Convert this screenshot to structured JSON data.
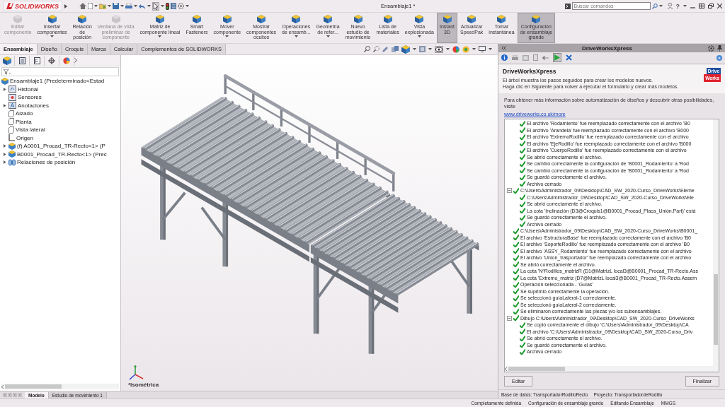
{
  "titlebar": {
    "logo": "SOLIDWORKS",
    "title": "Ensamblaje1 *",
    "search": {
      "placeholder": "Buscar comandos"
    },
    "help": "?"
  },
  "ribbon": [
    {
      "label": "Editar\ncomponente",
      "disabled": true,
      "selected": false,
      "dropdown": false
    },
    {
      "label": "Insertar\ncomponentes",
      "disabled": false,
      "selected": false,
      "dropdown": true
    },
    {
      "label": "Relación\nde\nposición",
      "disabled": false,
      "selected": false,
      "dropdown": false
    },
    {
      "label": "Ventana de vista\npreliminar de\ncomponente",
      "disabled": true,
      "selected": false,
      "dropdown": false
    },
    {
      "label": "Matriz de\ncomponente lineal",
      "disabled": false,
      "selected": false,
      "dropdown": true
    },
    {
      "label": "Smart\nFasteners",
      "disabled": false,
      "selected": false,
      "dropdown": false
    },
    {
      "label": "Mover\ncomponente",
      "disabled": false,
      "selected": false,
      "dropdown": true
    },
    {
      "label": "Mostrar\ncomponentes\nocultos",
      "disabled": false,
      "selected": false,
      "dropdown": false
    },
    {
      "label": "Operaciones\nde ensamb...",
      "disabled": false,
      "selected": false,
      "dropdown": true
    },
    {
      "label": "Geometría\nde refer...",
      "disabled": false,
      "selected": false,
      "dropdown": true
    },
    {
      "label": "Nuevo\nestudio de\nmovimiento",
      "disabled": false,
      "selected": false,
      "dropdown": false
    },
    {
      "label": "Lista de\nmateriales",
      "disabled": false,
      "selected": false,
      "dropdown": false
    },
    {
      "label": "Vista\nexplosionada",
      "disabled": false,
      "selected": false,
      "dropdown": true
    },
    {
      "label": "Instant\n3D",
      "disabled": false,
      "selected": true,
      "dropdown": false
    },
    {
      "label": "Actualizar\nSpeedPak",
      "disabled": false,
      "selected": false,
      "dropdown": false
    },
    {
      "label": "Tomar\ninstantánea",
      "disabled": false,
      "selected": false,
      "dropdown": false
    },
    {
      "label": "Configuración\nde ensamblaje\ngrande",
      "disabled": false,
      "selected": true,
      "dropdown": false
    }
  ],
  "command_tabs": [
    {
      "label": "Ensamblaje",
      "selected": true
    },
    {
      "label": "Diseño",
      "selected": false
    },
    {
      "label": "Croquis",
      "selected": false
    },
    {
      "label": "Marca",
      "selected": false
    },
    {
      "label": "Calcular",
      "selected": false
    },
    {
      "label": "Complementos de SOLIDWORKS",
      "selected": false
    }
  ],
  "feature_tree": {
    "items": [
      {
        "label": "Ensamblaje1  (Predeterminado<Estad",
        "kind": "assembly",
        "children": [
          {
            "label": "Historial",
            "kind": "history",
            "expanded": false
          },
          {
            "label": "Sensores",
            "kind": "sensor"
          },
          {
            "label": "Anotaciones",
            "kind": "annotation",
            "expanded": false
          },
          {
            "label": "Alzado",
            "kind": "plane"
          },
          {
            "label": "Planta",
            "kind": "plane"
          },
          {
            "label": "Vista lateral",
            "kind": "plane"
          },
          {
            "label": "Origen",
            "kind": "origin"
          },
          {
            "label": "(f) A0001_Procad_TR-Recto<1> (P",
            "kind": "assembly",
            "expanded": false
          },
          {
            "label": "B0001_Procad_TR-Recto<1> (Prec",
            "kind": "assembly",
            "expanded": false
          },
          {
            "label": "Relaciones de posición",
            "kind": "mates",
            "expanded": false
          }
        ]
      }
    ]
  },
  "viewport": {
    "view_name": "*Isométrica"
  },
  "drive_works": {
    "title": "DriveWorksXpress",
    "heading": "DriveWorksXpress",
    "description": "El árbol muestra los pasos seguidos para crear los modelos nuevos.\nHaga clic en Siguiente para volver a ejecutar el formulario y crear más modelos.",
    "logo": [
      "Drive",
      "Works"
    ],
    "info": "Para obtener más información sobre automatización de diseños y descubrir otras posibilidades, visite",
    "link": "www.driveworks.co.uk/more",
    "log": [
      {
        "children": [
          {
            "text": "El archivo 'Rodamiento' fue reemplazado correctamente con el archivo 'B0"
          },
          {
            "text": "El archivo 'Arandela' fue reemplazado correctamente con el archivo 'B000"
          },
          {
            "text": "El archivo 'ExtremoRodillo' fue reemplazado correctamente con el archivo"
          },
          {
            "text": "El archivo 'EjeRodillo' fue reemplazado correctamente con el archivo 'B000"
          },
          {
            "text": "El archivo 'CuerpoRodillo' fue reemplazado correctamente con el archivo"
          },
          {
            "text": "Se abrió correctamente el archivo."
          },
          {
            "text": "Se cambió correctamente la configuración de 'B0001_Rodamiento' a 'Rod"
          },
          {
            "text": "Se cambió correctamente la configuración de 'B0001_Rodamiento' a 'Rod"
          },
          {
            "text": "Se guardó correctamente el archivo."
          },
          {
            "text": "Archivo cerrado"
          }
        ]
      },
      {
        "text": "C:\\Users\\Administrador_09\\Desktop\\CAD_SW_2020-Curso_DriveWorks\\Eleme",
        "expanded": true,
        "children": [
          {
            "text": "C:\\Users\\Administrador_09\\Desktop\\CAD_SW_2020-Curso_DriveWorks\\Ele"
          },
          {
            "text": "Se abrió correctamente el archivo."
          },
          {
            "text": "La cota 'Inclinación (D3@Croquis1@B0001_Procad_Placa_Unión.Part)' está"
          },
          {
            "text": "Se guardó correctamente el archivo."
          },
          {
            "text": "Archivo cerrado"
          }
        ]
      },
      {
        "text": "C:\\Users\\Administrador_09\\Desktop\\CAD_SW_2020-Curso_DriveWorks\\B0001_"
      },
      {
        "text": "El archivo 'EstructuraBase' fue reemplazado correctamente con el archivo 'B0"
      },
      {
        "text": "El archivo 'SoporteRodillo' fue reemplazado correctamente con el archivo 'B0"
      },
      {
        "text": "El archivo 'ASSY_Rodamiento' fue reemplazado correctamente con el archivo"
      },
      {
        "text": "El archivo 'Union_trasportador' fue reemplazado correctamente con el archivo"
      },
      {
        "text": "Se abrió correctamente el archivo."
      },
      {
        "text": "La cota 'NºRodillos_matrizR (D1@MatrizL local3@B0001_Procad_TR-Recto.Ass"
      },
      {
        "text": "La cota 'Extremo_matriz (D7@MatrizL local3@B0001_Procad_TR-Recto.Assem"
      },
      {
        "text": "Operación seleccionada - 'Guías'"
      },
      {
        "text": "Se suprimió correctamente la operación."
      },
      {
        "text": "Se seleccionó guíaLateral-1 correctamente."
      },
      {
        "text": "Se seleccionó guíaLateral-2 correctamente."
      },
      {
        "text": "Se eliminaron correctamente las piezas y/o los subensamblajes."
      },
      {
        "text": "Dibujo C:\\Users\\Administrador_09\\Desktop\\CAD_SW_2020-Curso_DriveWorks",
        "expanded": true,
        "children": [
          {
            "text": "Se copió correctamente el dibujo 'C:\\Users\\Administrador_09\\Desktop\\CA"
          },
          {
            "text": "El archivo 'C:\\Users\\Administrador_09\\Desktop\\CAD_SW_2020-Curso_Driv"
          },
          {
            "text": "Se abrió correctamente el archivo."
          },
          {
            "text": "Se guardó correctamente el archivo."
          },
          {
            "text": "Archivo cerrado"
          }
        ]
      }
    ],
    "buttons": [
      "Editar",
      "Finalizar"
    ],
    "database": "Base de datos: TransportadorRodilloRecto",
    "project": "Proyecto: TransportadordeRodillo"
  },
  "bottom_tabs": [
    {
      "label": "Modelo",
      "selected": true
    },
    {
      "label": "Estudio de movimiento 1",
      "selected": false
    }
  ],
  "status_bar": [
    "Completamente definida",
    "Configuración de ensamblaje grande",
    "Editando Ensamblaje",
    "MMGS"
  ]
}
